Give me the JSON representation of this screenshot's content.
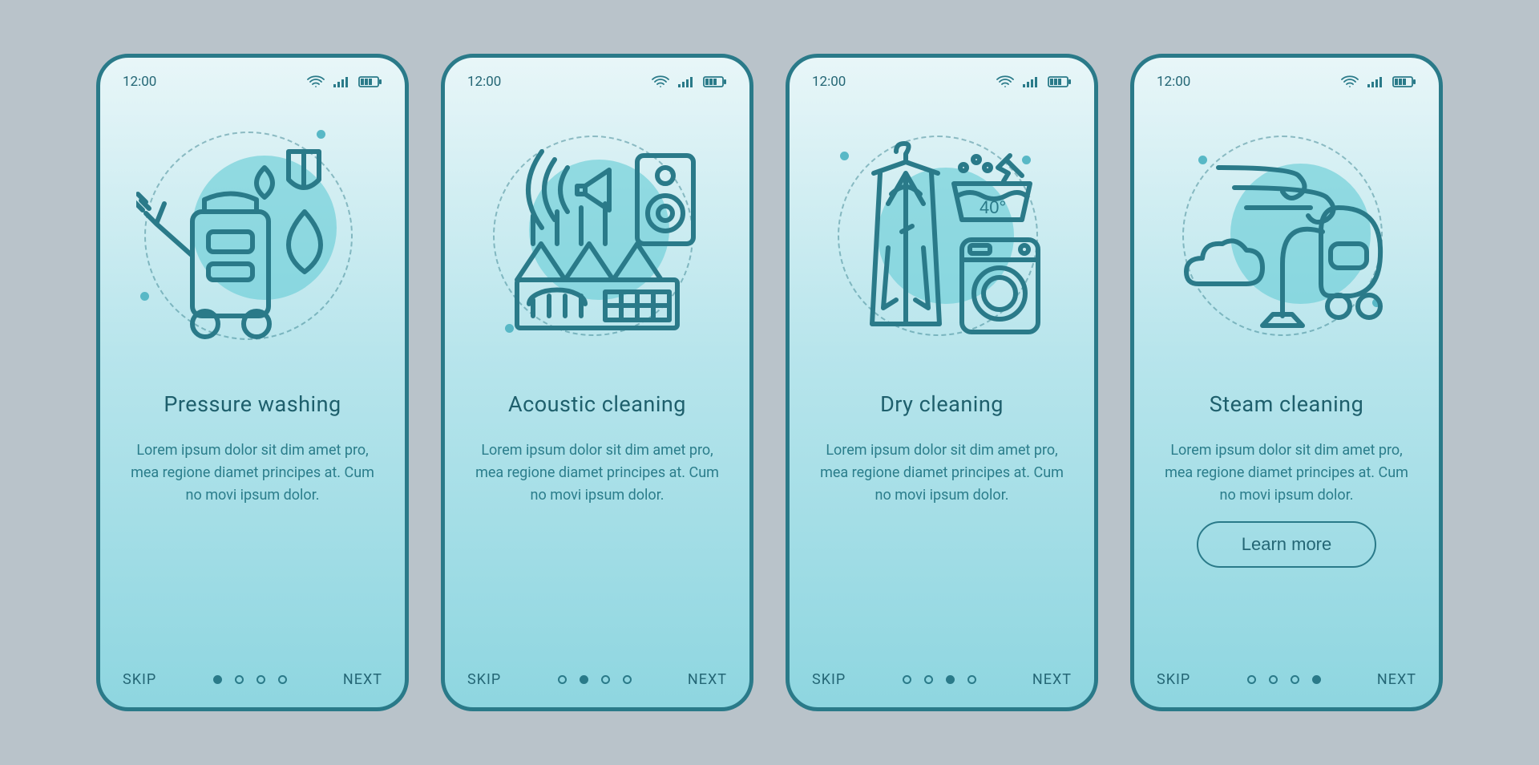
{
  "status_time": "12:00",
  "skip_label": "SKIP",
  "next_label": "NEXT",
  "learn_more_label": "Learn more",
  "lorem": "Lorem ipsum dolor sit dim amet pro, mea regione diamet principes at. Cum no movi ipsum dolor.",
  "screens": [
    {
      "title": "Pressure washing",
      "active_dot": 0,
      "icon": "pressure-washer-icon"
    },
    {
      "title": "Acoustic cleaning",
      "active_dot": 1,
      "icon": "acoustic-speaker-icon"
    },
    {
      "title": "Dry cleaning",
      "active_dot": 2,
      "icon": "dry-clean-icon"
    },
    {
      "title": "Steam cleaning",
      "active_dot": 3,
      "icon": "steam-vacuum-icon",
      "cta": true
    }
  ]
}
